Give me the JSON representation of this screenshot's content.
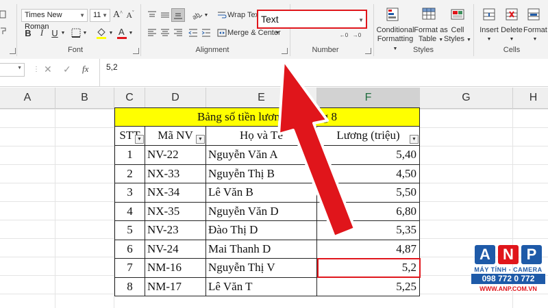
{
  "ribbon": {
    "font": {
      "font_name": "Times New Roman",
      "font_size": "11",
      "bold": "B",
      "italic": "I",
      "underline": "U",
      "group_label": "Font"
    },
    "alignment": {
      "wrap_text": "Wrap Text",
      "merge_center": "Merge & Center",
      "group_label": "Alignment"
    },
    "number": {
      "format_value": "Text",
      "group_label": "Number"
    },
    "styles": {
      "conditional_formatting": [
        "Conditional",
        "Formatting"
      ],
      "format_as_table": [
        "Format as",
        "Table"
      ],
      "cell_styles": [
        "Cell",
        "Styles"
      ],
      "group_label": "Styles"
    },
    "cells": {
      "insert": "Insert",
      "delete": "Delete",
      "format": "Format",
      "group_label": "Cells"
    }
  },
  "formula_bar": {
    "fx": "fx",
    "value": "5,2"
  },
  "columns": [
    "A",
    "B",
    "C",
    "D",
    "E",
    "F",
    "G",
    "H"
  ],
  "table": {
    "title": "Bảng số tiền lươn",
    "title_tail": "g 8",
    "headers": [
      "STT",
      "Mã NV",
      "Họ và Tê",
      "Lương (triệu)"
    ],
    "rows": [
      [
        "1",
        "NV-22",
        "Nguyễn Văn A",
        "5,40"
      ],
      [
        "2",
        "NX-33",
        "Nguyễn Thị B",
        "4,50"
      ],
      [
        "3",
        "NX-34",
        "Lê Văn B",
        "5,50"
      ],
      [
        "4",
        "NX-35",
        "Nguyễn Văn D",
        "6,80"
      ],
      [
        "5",
        "NV-23",
        "Đào Thị D",
        "5,35"
      ],
      [
        "6",
        "NV-24",
        "Mai Thanh D",
        "4,87"
      ],
      [
        "7",
        "NM-16",
        "Nguyễn Thị V",
        "5,2"
      ],
      [
        "8",
        "NM-17",
        "Lê Văn T",
        "5,25"
      ]
    ]
  },
  "logo": {
    "letters": [
      "A",
      "N",
      "P"
    ],
    "line1": "MÁY TÍNH - CAMERA",
    "phone": "098 772 0 772",
    "site": "WWW.ANP.COM.VN"
  },
  "colors": {
    "accent_red": "#e0151b",
    "title_fill": "#ffff00",
    "excel_green": "#217346",
    "logo_blue": "#1e5aa8"
  },
  "annotation": "red-arrow-pointing-to-number-format-dropdown"
}
